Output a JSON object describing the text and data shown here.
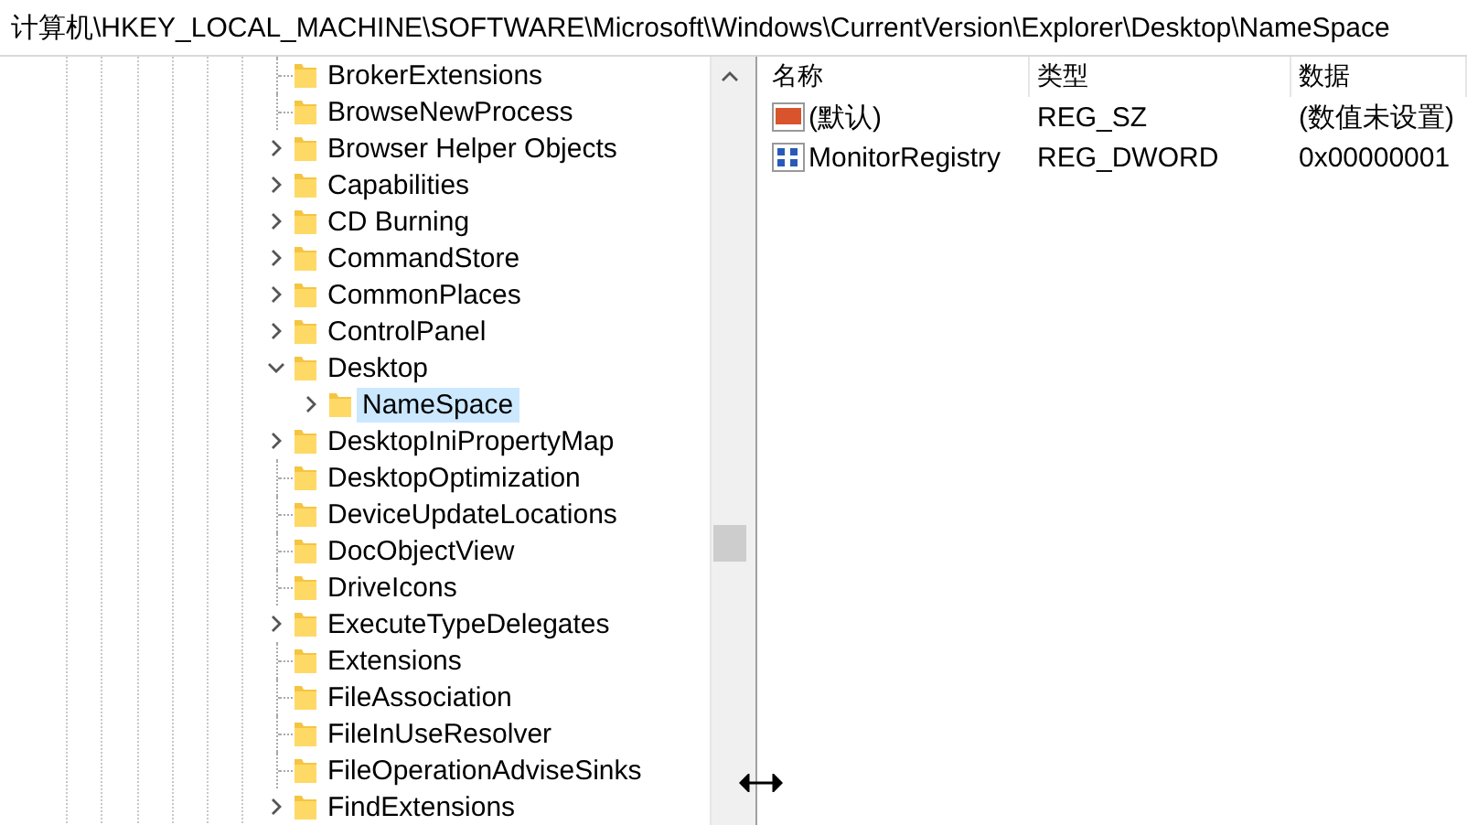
{
  "address_bar": {
    "path": "计算机\\HKEY_LOCAL_MACHINE\\SOFTWARE\\Microsoft\\Windows\\CurrentVersion\\Explorer\\Desktop\\NameSpace"
  },
  "tree": {
    "items": [
      {
        "label": "BrokerExtensions",
        "expandable": false,
        "selected": false
      },
      {
        "label": "BrowseNewProcess",
        "expandable": false,
        "selected": false
      },
      {
        "label": "Browser Helper Objects",
        "expandable": true,
        "expanded": false,
        "selected": false
      },
      {
        "label": "Capabilities",
        "expandable": true,
        "expanded": false,
        "selected": false
      },
      {
        "label": "CD Burning",
        "expandable": true,
        "expanded": false,
        "selected": false
      },
      {
        "label": "CommandStore",
        "expandable": true,
        "expanded": false,
        "selected": false
      },
      {
        "label": "CommonPlaces",
        "expandable": true,
        "expanded": false,
        "selected": false
      },
      {
        "label": "ControlPanel",
        "expandable": true,
        "expanded": false,
        "selected": false
      },
      {
        "label": "Desktop",
        "expandable": true,
        "expanded": true,
        "selected": false,
        "children": [
          {
            "label": "NameSpace",
            "expandable": true,
            "expanded": false,
            "selected": true
          }
        ]
      },
      {
        "label": "DesktopIniPropertyMap",
        "expandable": true,
        "expanded": false,
        "selected": false
      },
      {
        "label": "DesktopOptimization",
        "expandable": false,
        "selected": false
      },
      {
        "label": "DeviceUpdateLocations",
        "expandable": false,
        "selected": false
      },
      {
        "label": "DocObjectView",
        "expandable": false,
        "selected": false
      },
      {
        "label": "DriveIcons",
        "expandable": false,
        "selected": false
      },
      {
        "label": "ExecuteTypeDelegates",
        "expandable": true,
        "expanded": false,
        "selected": false
      },
      {
        "label": "Extensions",
        "expandable": false,
        "selected": false
      },
      {
        "label": "FileAssociation",
        "expandable": false,
        "selected": false
      },
      {
        "label": "FileInUseResolver",
        "expandable": false,
        "selected": false
      },
      {
        "label": "FileOperationAdviseSinks",
        "expandable": false,
        "selected": false
      },
      {
        "label": "FindExtensions",
        "expandable": true,
        "expanded": false,
        "selected": false
      }
    ]
  },
  "values": {
    "columns": [
      "名称",
      "类型",
      "数据"
    ],
    "rows": [
      {
        "kind": "string",
        "name": "(默认)",
        "type": "REG_SZ",
        "data": "(数值未设置)"
      },
      {
        "kind": "binary",
        "name": "MonitorRegistry",
        "type": "REG_DWORD",
        "data": "0x00000001"
      }
    ]
  }
}
